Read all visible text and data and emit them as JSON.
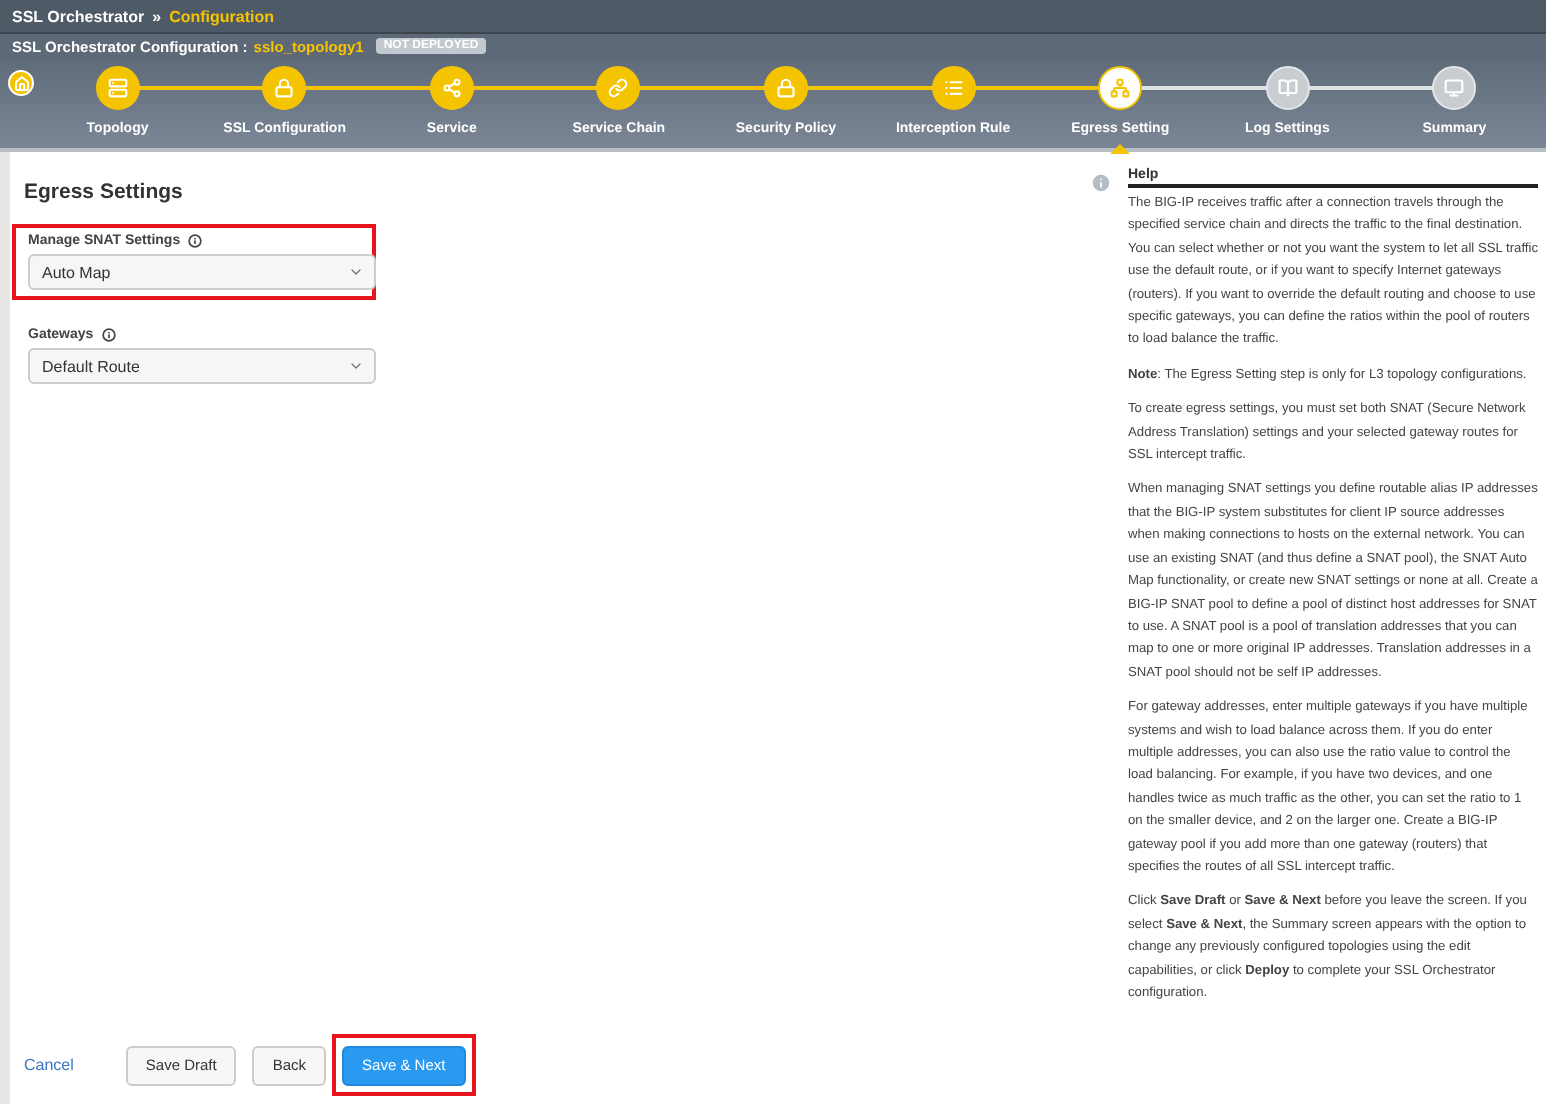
{
  "breadcrumb": {
    "root": "SSL Orchestrator",
    "separator": "»",
    "current": "Configuration"
  },
  "config_bar": {
    "label": "SSL Orchestrator Configuration :",
    "name": "sslo_topology1",
    "badge": "NOT DEPLOYED"
  },
  "steps": [
    {
      "label": "Topology",
      "kind": "stack",
      "completed": true,
      "selected": false
    },
    {
      "label": "SSL Configuration",
      "kind": "lock",
      "completed": true,
      "selected": false
    },
    {
      "label": "Service",
      "kind": "share",
      "completed": true,
      "selected": false
    },
    {
      "label": "Service Chain",
      "kind": "link",
      "completed": true,
      "selected": false
    },
    {
      "label": "Security Policy",
      "kind": "lock",
      "completed": true,
      "selected": false
    },
    {
      "label": "Interception Rule",
      "kind": "list",
      "completed": true,
      "selected": false
    },
    {
      "label": "Egress Setting",
      "kind": "network",
      "completed": false,
      "selected": true
    },
    {
      "label": "Log Settings",
      "kind": "book",
      "completed": false,
      "selected": false
    },
    {
      "label": "Summary",
      "kind": "monitor",
      "completed": false,
      "selected": false
    }
  ],
  "form": {
    "title": "Egress Settings",
    "fields": [
      {
        "label": "Manage SNAT Settings",
        "value": "Auto Map",
        "highlighted": true
      },
      {
        "label": "Gateways",
        "value": "Default Route",
        "highlighted": false
      }
    ]
  },
  "help": {
    "title": "Help",
    "paragraphs": [
      "The BIG-IP receives traffic after a connection travels through the specified service chain and directs the traffic to the final destination. You can select whether or not you want the system to let all SSL traffic use the default route, or if you want to specify Internet gateways (routers). If you want to override the default routing and choose to use specific gateways, you can define the ratios within the pool of routers to load balance the traffic.",
      "**Note**: The Egress Setting step is only for L3 topology configurations.",
      "To create egress settings, you must set both SNAT (Secure Network Address Translation) settings and your selected gateway routes for SSL intercept traffic.",
      "When managing SNAT settings you define routable alias IP addresses that the BIG-IP system substitutes for client IP source addresses when making connections to hosts on the external network. You can use an existing SNAT (and thus define a SNAT pool), the SNAT Auto Map functionality, or create new SNAT settings or none at all. Create a BIG-IP SNAT pool to define a pool of distinct host addresses for SNAT to use. A SNAT pool is a pool of translation addresses that you can map to one or more original IP addresses. Translation addresses in a SNAT pool should not be self IP addresses.",
      "For gateway addresses, enter multiple gateways if you have multiple systems and wish to load balance across them. If you do enter multiple addresses, you can also use the ratio value to control the load balancing. For example, if you have two devices, and one handles twice as much traffic as the other, you can set the ratio to 1 on the smaller device, and 2 on the larger one. Create a BIG-IP gateway pool if you add more than one gateway (routers) that specifies the routes of all SSL intercept traffic.",
      "Click **Save Draft** or **Save & Next** before you leave the screen. If you select **Save & Next**, the Summary screen appears with the option to change any previously configured topologies using the edit capabilities, or click **Deploy** to complete your SSL Orchestrator configuration."
    ]
  },
  "footer": {
    "cancel": "Cancel",
    "buttons": [
      {
        "label": "Save Draft",
        "kind": "default",
        "highlighted": false
      },
      {
        "label": "Back",
        "kind": "default",
        "highlighted": false
      },
      {
        "label": "Save & Next",
        "kind": "primary",
        "highlighted": true
      }
    ]
  }
}
